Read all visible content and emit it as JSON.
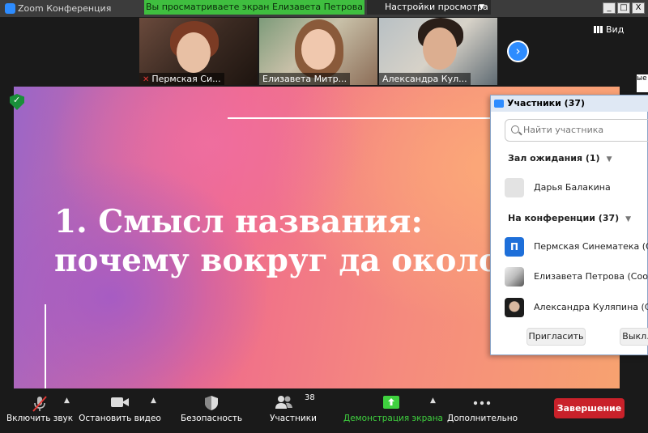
{
  "window": {
    "title": "Zoom Конференция",
    "share_banner": "Вы просматриваете экран Елизавета Петрова",
    "view_settings": "Настройки просмотра",
    "controls": [
      "_",
      "□",
      "X"
    ]
  },
  "video_strip": {
    "participants": [
      {
        "name": "Пермская Си...",
        "muted": true
      },
      {
        "name": "Елизавета Митр...",
        "muted": false
      },
      {
        "name": "Александра Кул...",
        "muted": false
      }
    ],
    "view_button": "Вид"
  },
  "background_edge_text": "ые",
  "slide": {
    "title_line1": "1. Смысл названия:",
    "title_line2": "почему вокруг да около?"
  },
  "participants_panel": {
    "title": "Участники (37)",
    "search_placeholder": "Найти участника",
    "waiting_section": "Зал ожидания (1)",
    "waiting": [
      {
        "name": "Дарья Балакина",
        "avatar": "blank"
      }
    ],
    "meeting_section": "На конференции (37)",
    "in_meeting": [
      {
        "name": "Пермская Синематека (Ор",
        "avatar": "П"
      },
      {
        "name": "Елизавета Петрова (Соорг",
        "avatar": "photo"
      },
      {
        "name": "Александра Куляпина (Сос",
        "avatar": "photo"
      }
    ],
    "invite_button": "Пригласить",
    "mute_button": "Выкл."
  },
  "toolbar": {
    "unmute": "Включить звук",
    "stop_video": "Остановить видео",
    "security": "Безопасность",
    "participants": "Участники",
    "participants_count": "38",
    "share_screen": "Демонстрация экрана",
    "more": "Дополнительно",
    "end": "Завершение"
  },
  "colors": {
    "accent": "#2d8cff",
    "share_green": "#3fbe3f",
    "end_red": "#c9212a",
    "toolbar_bg": "#1a1a1a"
  }
}
